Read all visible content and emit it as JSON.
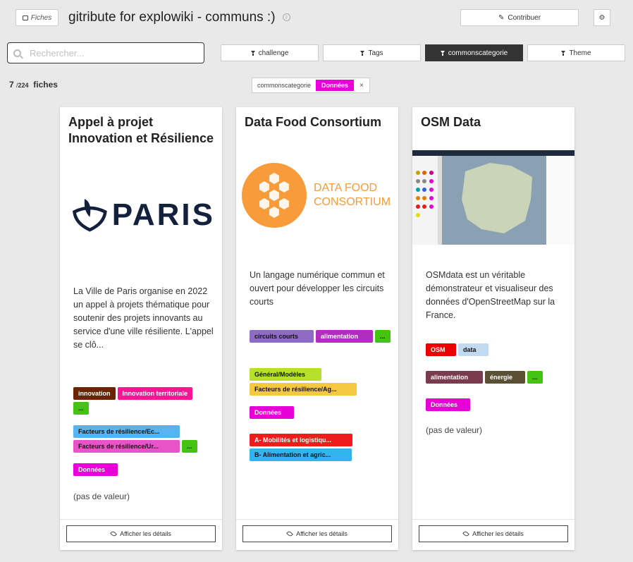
{
  "header": {
    "fiches_label": "Fiches",
    "title": "gitribute for explowiki - communs :)",
    "contribute_label": "Contribuer"
  },
  "search": {
    "placeholder": "Rechercher..."
  },
  "filters": [
    {
      "label": "challenge",
      "active": false
    },
    {
      "label": "Tags",
      "active": false
    },
    {
      "label": "commonscategorie",
      "active": true
    },
    {
      "label": "Theme",
      "active": false
    }
  ],
  "count": {
    "shown": "7",
    "separator": "/",
    "total": "224",
    "unit": "fiches"
  },
  "active_filter": {
    "key": "commonscategorie",
    "value": "Données",
    "remove": "×"
  },
  "cards": [
    {
      "title": "Appel à projet Innovation et Résilience",
      "logo_text": "PARIS",
      "description": "La Ville de Paris organise en 2022 un appel à projets thématique pour soutenir des projets innovants au service d'une ville résiliente. L'appel se clô...",
      "tags1": [
        "innovation",
        "Innovation territoriale",
        "..."
      ],
      "tags2": [
        "Facteurs de résilience/Ec...",
        "Facteurs de résilience/Ur...",
        "..."
      ],
      "tags3": [
        "Données"
      ],
      "no_value": "(pas de valeur)",
      "details": "Afficher les détails"
    },
    {
      "title": "Data Food Consortium",
      "logo_text_1": "DATA FOOD",
      "logo_text_2": "CONSORTIUM",
      "description": "Un langage numérique commun et ouvert pour développer les circuits courts",
      "tags1": [
        "circuits courts",
        "alimentation",
        "..."
      ],
      "tags2": [
        "Général/Modèles",
        "Facteurs de résilience/Ag..."
      ],
      "tags3": [
        "Données"
      ],
      "tags4": [
        "A- Mobilités et logistiqu...",
        "B- Alimentation et agric..."
      ],
      "details": "Afficher les détails"
    },
    {
      "title": "OSM Data",
      "description": "OSMdata est un véritable démonstrateur et visualiseur des données d'OpenStreetMap sur la France.",
      "tags1": [
        "OSM",
        "data"
      ],
      "tags2": [
        "alimentation",
        "énergie",
        "..."
      ],
      "tags3": [
        "Données"
      ],
      "no_value": "(pas de valeur)",
      "details": "Afficher les détails"
    }
  ],
  "colors": {
    "accent_magenta": "#e800d8",
    "tag_brown": "#6b2400",
    "tag_pink": "#ff1493",
    "tag_green": "#44c411",
    "tag_lightblue": "#56b4f0",
    "tag_hotpink": "#e854c8",
    "tag_purple": "#8e6bc4",
    "tag_violet": "#b12dbf",
    "tag_lime": "#b6e02b",
    "tag_yellow": "#f5c842",
    "tag_red": "#ef1c1c",
    "tag_sky": "#33b4ef",
    "tag_osm_red": "#ee0000",
    "tag_data_blue": "#c2daf0",
    "tag_maroon": "#7b3b4e",
    "tag_olive": "#5a5033",
    "paris_navy": "#14213d",
    "dfc_orange": "#f79b3b"
  }
}
